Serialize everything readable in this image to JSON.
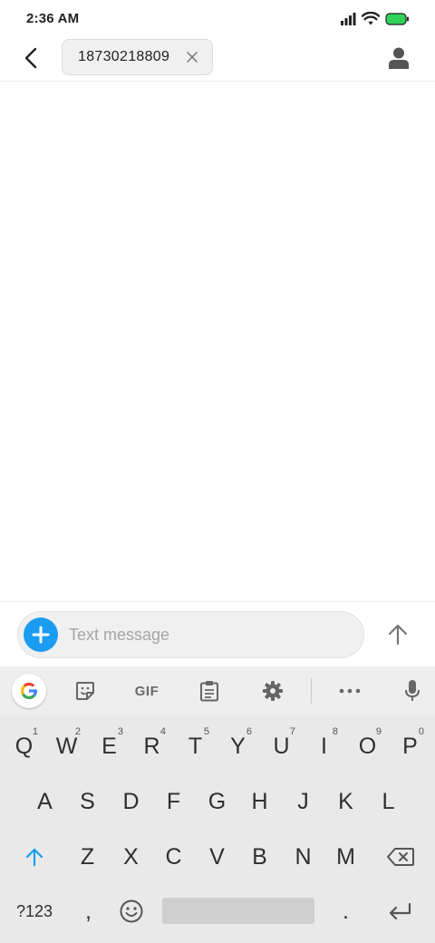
{
  "status_bar": {
    "time": "2:36 AM"
  },
  "header": {
    "recipient": "18730218809"
  },
  "compose": {
    "placeholder": "Text message"
  },
  "keyboard": {
    "toolbar": {
      "gif_label": "GIF"
    },
    "row1": [
      {
        "label": "Q",
        "hint": "1"
      },
      {
        "label": "W",
        "hint": "2"
      },
      {
        "label": "E",
        "hint": "3"
      },
      {
        "label": "R",
        "hint": "4"
      },
      {
        "label": "T",
        "hint": "5"
      },
      {
        "label": "Y",
        "hint": "6"
      },
      {
        "label": "U",
        "hint": "7"
      },
      {
        "label": "I",
        "hint": "8"
      },
      {
        "label": "O",
        "hint": "9"
      },
      {
        "label": "P",
        "hint": "0"
      }
    ],
    "row2": [
      "A",
      "S",
      "D",
      "F",
      "G",
      "H",
      "J",
      "K",
      "L"
    ],
    "row3": [
      "Z",
      "X",
      "C",
      "V",
      "B",
      "N",
      "M"
    ],
    "row4": {
      "symbols": "?123",
      "comma": ",",
      "period": "."
    }
  },
  "colors": {
    "accent": "#1a9cf0",
    "battery": "#2fd25a",
    "keyboard_bg": "#e9e9e9"
  },
  "icons": [
    "back-arrow-icon",
    "close-icon",
    "person-icon",
    "plus-icon",
    "send-arrow-icon",
    "google-icon",
    "sticker-icon",
    "clipboard-icon",
    "gear-icon",
    "more-icon",
    "mic-icon",
    "shift-icon",
    "backspace-icon",
    "emoji-icon",
    "enter-icon"
  ]
}
